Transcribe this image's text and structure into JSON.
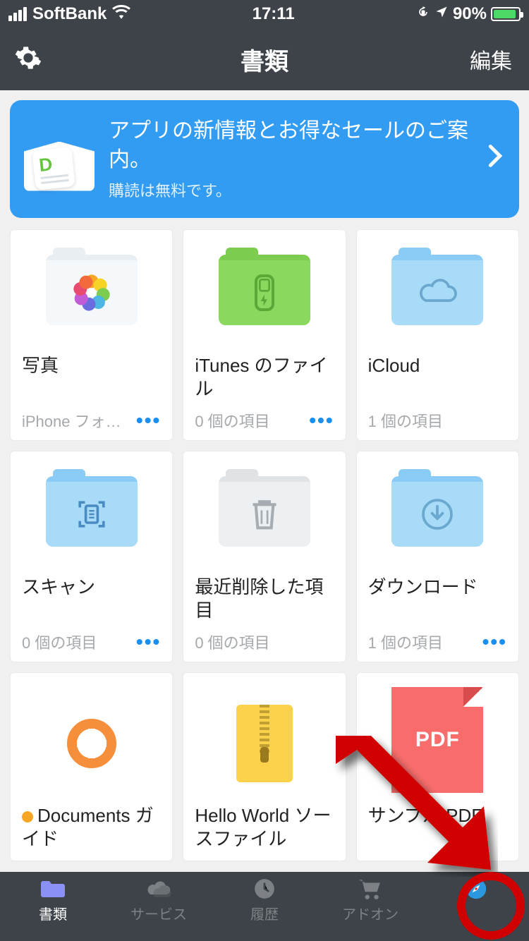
{
  "status": {
    "carrier": "SoftBank",
    "time": "17:11",
    "battery_pct": "90%"
  },
  "nav": {
    "title": "書類",
    "edit": "編集"
  },
  "banner": {
    "title": "アプリの新情報とお得なセールのご案内。",
    "subtitle": "購読は無料です。"
  },
  "tiles": [
    {
      "title": "写真",
      "subtitle": "iPhone フォトラ…",
      "more": true
    },
    {
      "title": "iTunes のファイル",
      "subtitle": "0 個の項目",
      "more": true
    },
    {
      "title": "iCloud",
      "subtitle": "1 個の項目",
      "more": false
    },
    {
      "title": "スキャン",
      "subtitle": "0 個の項目",
      "more": true
    },
    {
      "title": "最近削除した項目",
      "subtitle": "0 個の項目",
      "more": false
    },
    {
      "title": "ダウンロード",
      "subtitle": "1 個の項目",
      "more": true
    },
    {
      "title": "Documents ガイド",
      "subtitle": "",
      "more": false,
      "badge": true
    },
    {
      "title": "Hello World ソースファイル",
      "subtitle": "",
      "more": false
    },
    {
      "title": "サンプル PDF",
      "subtitle": "",
      "more": false
    }
  ],
  "tabs": {
    "documents": "書類",
    "services": "サービス",
    "history": "履歴",
    "addons": "アドオン",
    "browser": ""
  }
}
